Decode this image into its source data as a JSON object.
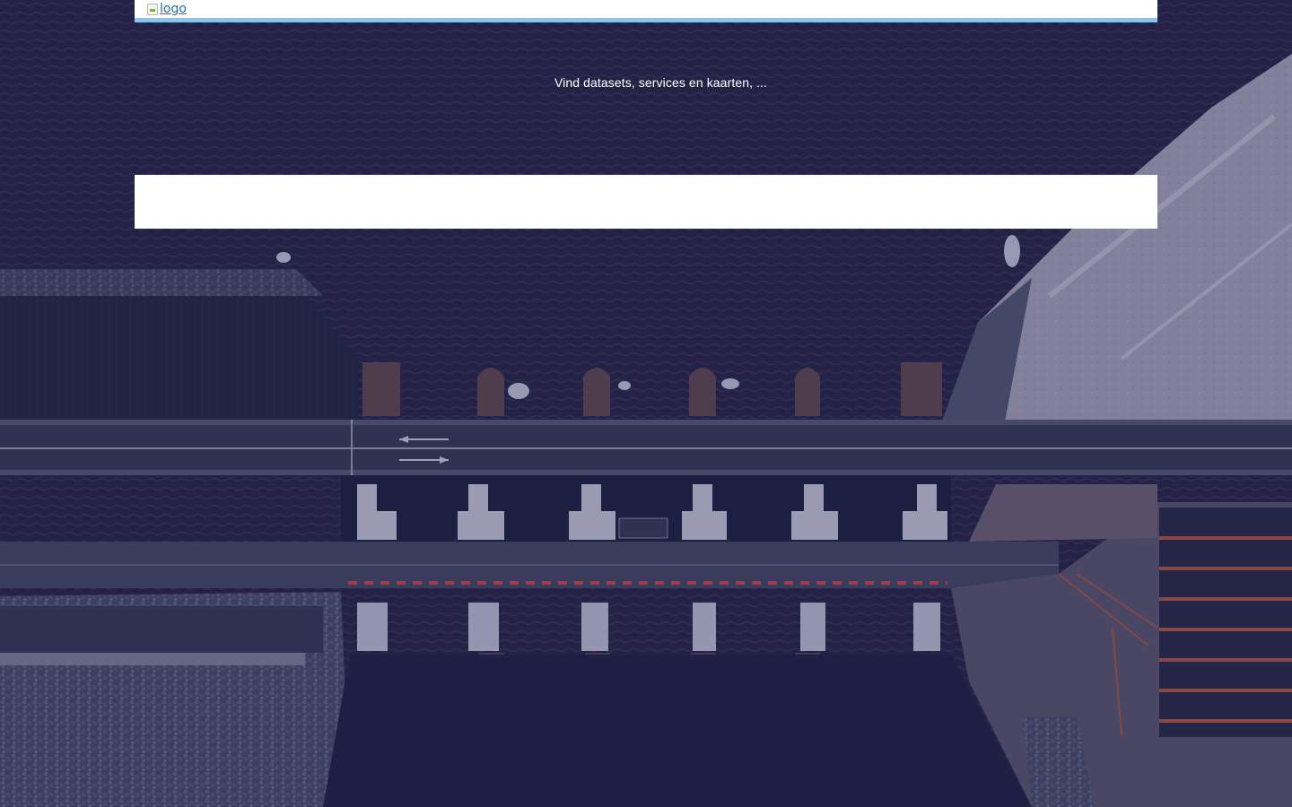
{
  "header": {
    "logo_alt": "logo"
  },
  "hero": {
    "tagline": "Vind datasets, services en kaarten, ..."
  },
  "search": {
    "value": "",
    "placeholder": ""
  },
  "colors": {
    "header_background": "#ffffff",
    "header_border": "#8fc3ec",
    "background_tint": "#1b1e3f",
    "panel_background": "#ffffff"
  },
  "background_image": "aerial photo of a dam with sluice gates and a road"
}
